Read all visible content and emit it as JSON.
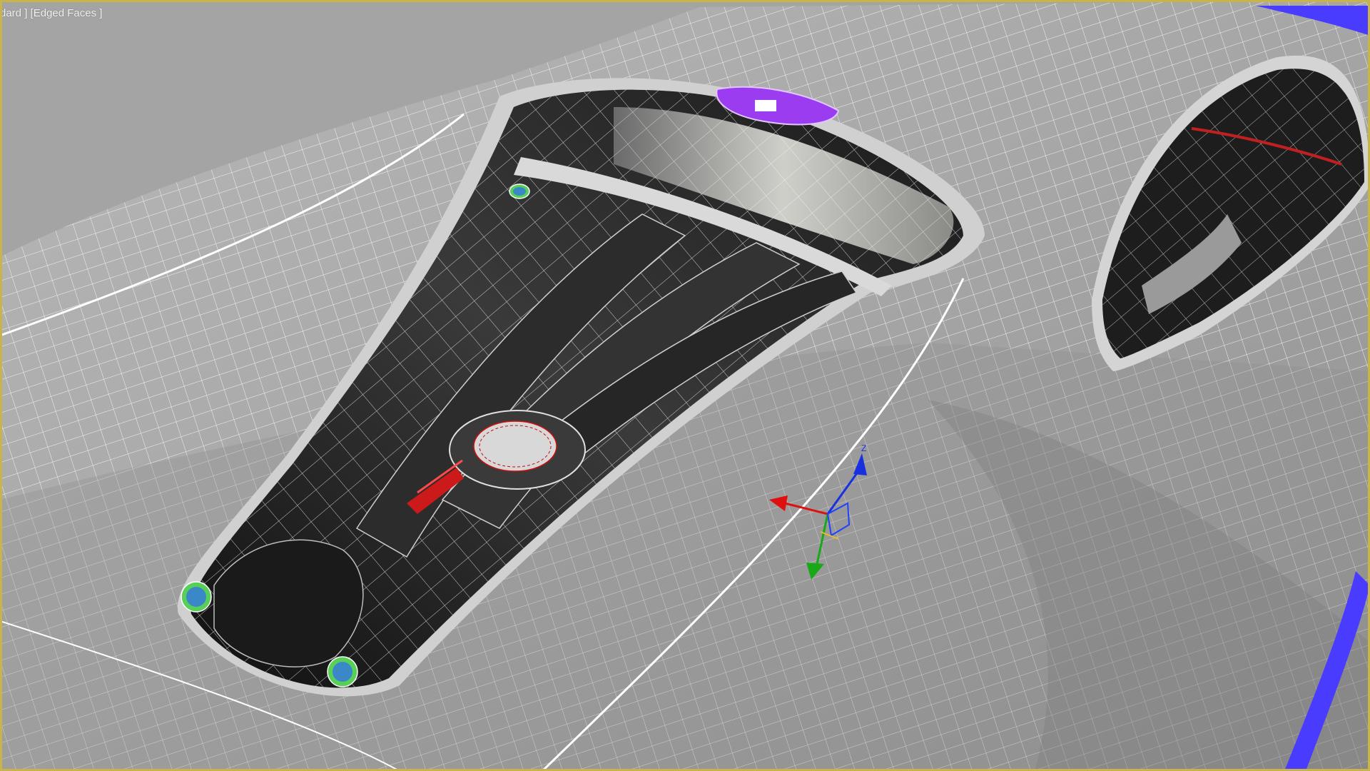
{
  "viewport": {
    "label": "dard ] [Edged Faces ]",
    "border_color": "#c9b44a",
    "background_color": "#9f9f9f",
    "wire_color": "#ffffff",
    "selection_color": "#9b3cf0",
    "edge_highlight_color": "#4a3cff"
  },
  "gizmo": {
    "x_label": "",
    "y_label": "",
    "z_label": "Z",
    "x_color": "#e01010",
    "y_color": "#18a818",
    "z_color": "#1830e0"
  },
  "markers": {
    "marker_color": "#58d058"
  }
}
